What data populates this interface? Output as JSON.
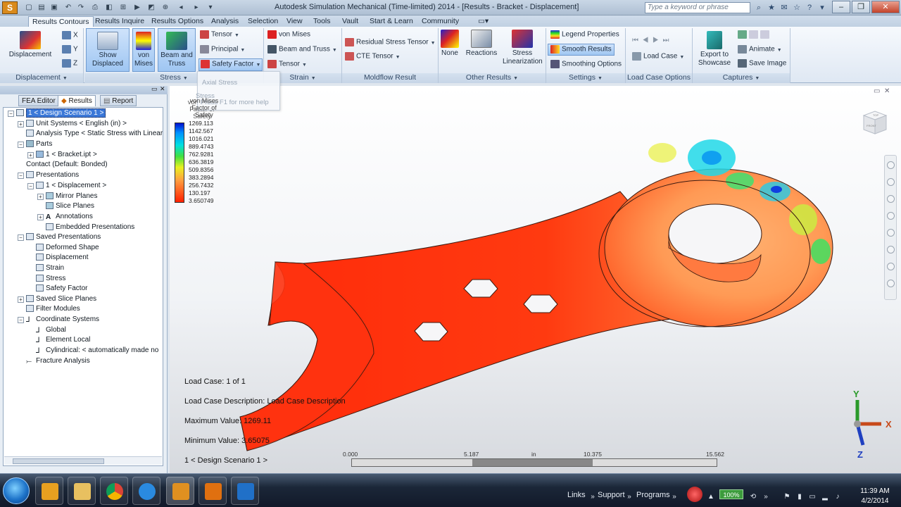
{
  "window": {
    "title": "Autodesk Simulation Mechanical (Time-limited) 2014 - [Results - Bracket - Displacement]",
    "search_placeholder": "Type a keyword or phrase",
    "app_icon_letter": "S"
  },
  "ribbon_tabs": [
    "Results Contours",
    "Results Inquire",
    "Results Options",
    "Analysis",
    "Selection",
    "View",
    "Tools",
    "Vault",
    "Start & Learn",
    "Community"
  ],
  "ribbon": {
    "displacement": {
      "label": "Displacement",
      "x": "X",
      "y": "Y",
      "z": "Z",
      "group": "Displacement"
    },
    "show_displaced": {
      "label": "Show Displaced"
    },
    "von_mises": {
      "label": "von Mises"
    },
    "beam_and_truss_big": {
      "label": "Beam and Truss"
    },
    "stress_menu": {
      "tensor": "Tensor",
      "principal": "Principal",
      "safety_factor": "Safety Factor",
      "group": "Stress"
    },
    "strain_menu": {
      "von_mises": "von Mises",
      "beam_and_truss": "Beam and Truss",
      "tensor": "Tensor",
      "group": "Strain"
    },
    "moldflow": {
      "residual": "Residual Stress Tensor",
      "cte": "CTE Tensor",
      "group": "Moldflow Result"
    },
    "other": {
      "none": "None",
      "reactions": "Reactions",
      "stress_lin": "Stress Linearization",
      "group": "Other Results"
    },
    "settings": {
      "legend": "Legend Properties",
      "smooth": "Smooth Results",
      "smoothing": "Smoothing Options",
      "group": "Settings"
    },
    "load_case": {
      "label": "Load Case",
      "group": "Load Case Options"
    },
    "captures": {
      "export": "Export to Showcase",
      "animate": "Animate",
      "save_image": "Save Image",
      "group": "Captures"
    }
  },
  "tooltip": {
    "axial": "Axial Stress",
    "stress": "Stress",
    "press": "Press F1 for more help"
  },
  "left_panel": {
    "tabs": [
      "FEA Editor",
      "Results",
      "Report"
    ],
    "tree": [
      {
        "label": "1 < Design Scenario 1 >"
      },
      {
        "label": "Unit Systems < English (in) >"
      },
      {
        "label": "Analysis Type < Static Stress with Linear"
      },
      {
        "label": "Parts"
      },
      {
        "label": "1 < Bracket.ipt >"
      },
      {
        "label": "Contact (Default: Bonded)"
      },
      {
        "label": "Presentations"
      },
      {
        "label": "1 < Displacement >"
      },
      {
        "label": "Mirror Planes"
      },
      {
        "label": "Slice Planes"
      },
      {
        "label": "Annotations"
      },
      {
        "label": "Embedded Presentations"
      },
      {
        "label": "Saved Presentations"
      },
      {
        "label": "Deformed Shape"
      },
      {
        "label": "Displacement"
      },
      {
        "label": "Strain"
      },
      {
        "label": "Stress"
      },
      {
        "label": "Safety Factor"
      },
      {
        "label": "Saved Slice Planes"
      },
      {
        "label": "Filter Modules"
      },
      {
        "label": "Coordinate Systems"
      },
      {
        "label": "Global"
      },
      {
        "label": "Element Local"
      },
      {
        "label": "Cylindrical: < automatically made no"
      },
      {
        "label": "Fracture Analysis"
      }
    ]
  },
  "viewport": {
    "legend_title": "von Mises Factor of Safety",
    "legend_values": [
      "1269.113",
      "1142.567",
      "1016.021",
      "889.4743",
      "762.9281",
      "636.3819",
      "509.8356",
      "383.2894",
      "256.7432",
      "130.197",
      "3.650749"
    ],
    "load_case": "Load Case:  1 of 1",
    "load_case_desc": "Load Case Description:  Load Case Description",
    "max_value": "Maximum Value:  1269.11",
    "min_value": "Minimum Value:  3.65075",
    "scenario": "1 < Design Scenario 1 >",
    "scale_labels": [
      "0.000",
      "5.187",
      "in",
      "10.375",
      "15.562"
    ],
    "axes": {
      "x": "X",
      "y": "Y",
      "z": "Z"
    },
    "viewcube": {
      "top": "TOP",
      "front": "FRONT"
    }
  },
  "taskbar": {
    "toolbars": [
      "Links",
      "Support",
      "Programs"
    ],
    "battery": "100%",
    "time": "11:39 AM",
    "date": "4/2/2014"
  }
}
